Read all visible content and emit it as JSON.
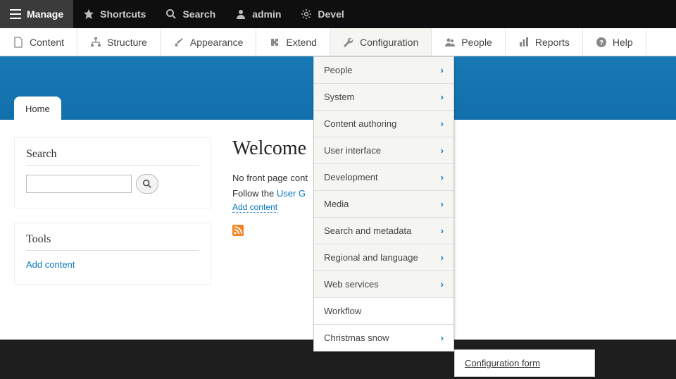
{
  "topbar": {
    "manage": "Manage",
    "shortcuts": "Shortcuts",
    "search": "Search",
    "admin": "admin",
    "devel": "Devel"
  },
  "toolbar": {
    "content": "Content",
    "structure": "Structure",
    "appearance": "Appearance",
    "extend": "Extend",
    "configuration": "Configuration",
    "people": "People",
    "reports": "Reports",
    "help": "Help"
  },
  "tabs": {
    "home": "Home"
  },
  "search_block": {
    "title": "Search"
  },
  "tools_block": {
    "title": "Tools",
    "add_content": "Add content"
  },
  "main": {
    "heading": "Welcome",
    "no_front": "No front page cont",
    "follow": "Follow the ",
    "user_guide": "User G",
    "add_content": "Add content"
  },
  "config_menu": {
    "items": [
      "People",
      "System",
      "Content authoring",
      "User interface",
      "Development",
      "Media",
      "Search and metadata",
      "Regional and language",
      "Web services",
      "Workflow",
      "Christmas snow"
    ],
    "has_children": [
      true,
      true,
      true,
      true,
      true,
      true,
      true,
      true,
      true,
      false,
      true
    ]
  },
  "submenu": {
    "config_form": "Configuration form"
  }
}
